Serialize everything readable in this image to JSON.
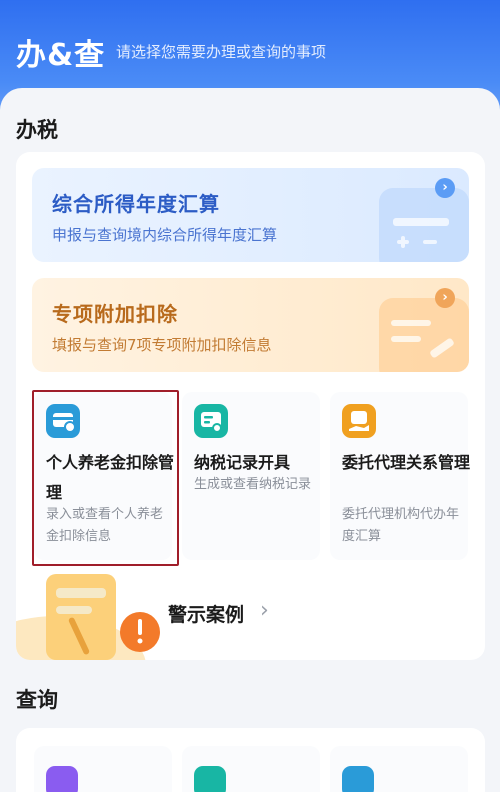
{
  "header": {
    "title": "办&查",
    "subtitle": "请选择您需要办理或查询的事项"
  },
  "sections": {
    "tax": {
      "title": "办税"
    },
    "query": {
      "title": "查询"
    }
  },
  "banners": [
    {
      "title": "综合所得年度汇算",
      "subtitle": "申报与查询境内综合所得年度汇算",
      "color": "#2c5cc5"
    },
    {
      "title": "专项附加扣除",
      "subtitle": "填报与查询7项专项附加扣除信息",
      "color": "#b86a1c"
    }
  ],
  "services": [
    {
      "title": "个人养老金扣除管理",
      "desc": "录入或查看个人养老金扣除信息",
      "icon": "pension-card-icon",
      "color": "#2a9bd8"
    },
    {
      "title": "纳税记录开具",
      "desc": "生成或查看纳税记录",
      "icon": "tax-record-icon",
      "color": "#18b6a4"
    },
    {
      "title": "委托代理关系管理",
      "desc": "委托代理机构代办年度汇算",
      "icon": "agency-icon",
      "color": "#f0a020"
    }
  ],
  "warning": {
    "label": "警示案例",
    "chevron": "›"
  },
  "chevron": "›"
}
